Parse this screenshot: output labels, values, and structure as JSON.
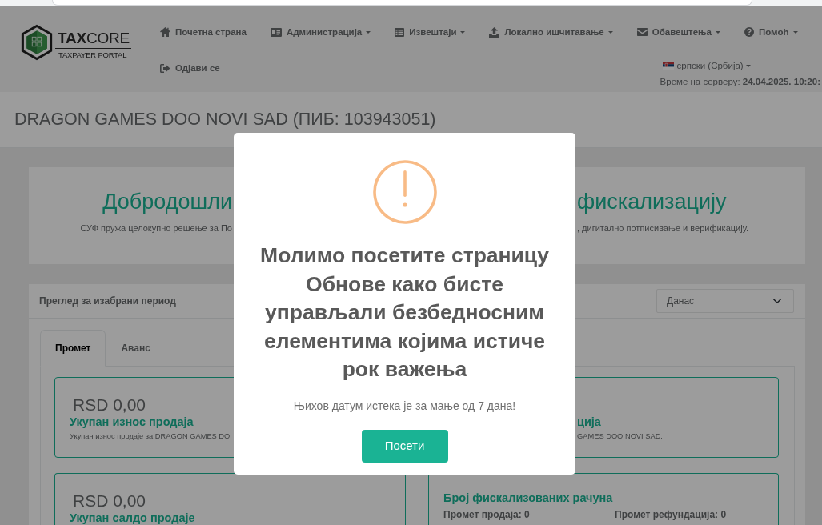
{
  "navbar": {
    "logo": {
      "name": "**TAX**CORE",
      "tagline": "TAXPAYER PORTAL"
    },
    "menu": [
      {
        "label": "Почетна страна",
        "dropdown": false
      },
      {
        "label": "Администрација",
        "dropdown": true
      },
      {
        "label": "Извештаји",
        "dropdown": true
      },
      {
        "label": "Локално ишчитавање",
        "dropdown": true
      },
      {
        "label": "Обавештења",
        "dropdown": true
      },
      {
        "label": "Помоћ",
        "dropdown": true
      }
    ],
    "logout": {
      "label": "Одјави се"
    },
    "language": {
      "label": "српски (Србија)",
      "dropdown": true
    },
    "server_time": {
      "label": "Време на серверу:",
      "value": "24.04.2025. 10:20:"
    }
  },
  "page_title": "DRAGON GAMES DOO NOVI SAD (ПИБ: 103943051)",
  "welcome": {
    "heading": [
      "Добродошли",
      "фискализацију"
    ],
    "text": [
      "СУФ пружа целокупно решење за По",
      ", дигитално потписивање и верификацију."
    ]
  },
  "overview": {
    "title": "Преглед за изабрани период",
    "period": {
      "value": "Данас"
    },
    "tabs": [
      {
        "label": "Промет",
        "selected": true
      },
      {
        "label": "Аванс",
        "selected": false
      }
    ],
    "cards": [
      {
        "amount": "RSD 0,00",
        "title": "Укупан износ продаја",
        "description": "Укупан износ продаје за DRAGON GAMES DO"
      },
      {
        "title": "ција",
        "description": "GAMES DOO NOVI SAD."
      },
      {
        "amount": "RSD 0,00",
        "title": "Укупан салдо продаје"
      },
      {
        "title": "Број фискализованих рачуна",
        "counts": [
          "Промет продаја: 0",
          "Промет рефундација: 0"
        ]
      }
    ]
  },
  "modal": {
    "title": "Молимо посетите страницу Обнове како бисте управљали безбедносним елементима којима истиче рок важења",
    "text": "Њихов датум истека је за мање од 7 дана!",
    "button": "Посети"
  }
}
